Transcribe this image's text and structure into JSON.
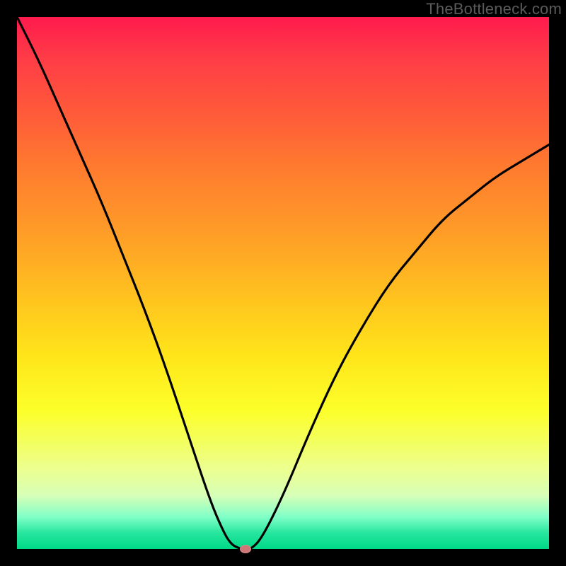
{
  "watermark": "TheBottleneck.com",
  "chart_data": {
    "type": "line",
    "title": "",
    "xlabel": "",
    "ylabel": "",
    "xlim": [
      0,
      100
    ],
    "ylim": [
      0,
      100
    ],
    "series": [
      {
        "name": "bottleneck-curve",
        "x": [
          0,
          4,
          8,
          12,
          16,
          20,
          24,
          28,
          32,
          36,
          38,
          40,
          42,
          43,
          44,
          46,
          50,
          55,
          60,
          65,
          70,
          75,
          80,
          85,
          90,
          95,
          100
        ],
        "y": [
          100,
          92,
          83,
          74,
          65,
          55,
          45,
          34,
          22,
          10,
          5,
          1,
          0,
          0,
          0,
          2,
          10,
          22,
          33,
          42,
          50,
          56,
          62,
          66,
          70,
          73,
          76
        ]
      }
    ],
    "marker": {
      "x": 43,
      "y": 0,
      "color": "#cf7777"
    },
    "grid": false,
    "legend": false
  },
  "colors": {
    "curve": "#000000",
    "frame": "#000000",
    "marker": "#cf7777"
  }
}
